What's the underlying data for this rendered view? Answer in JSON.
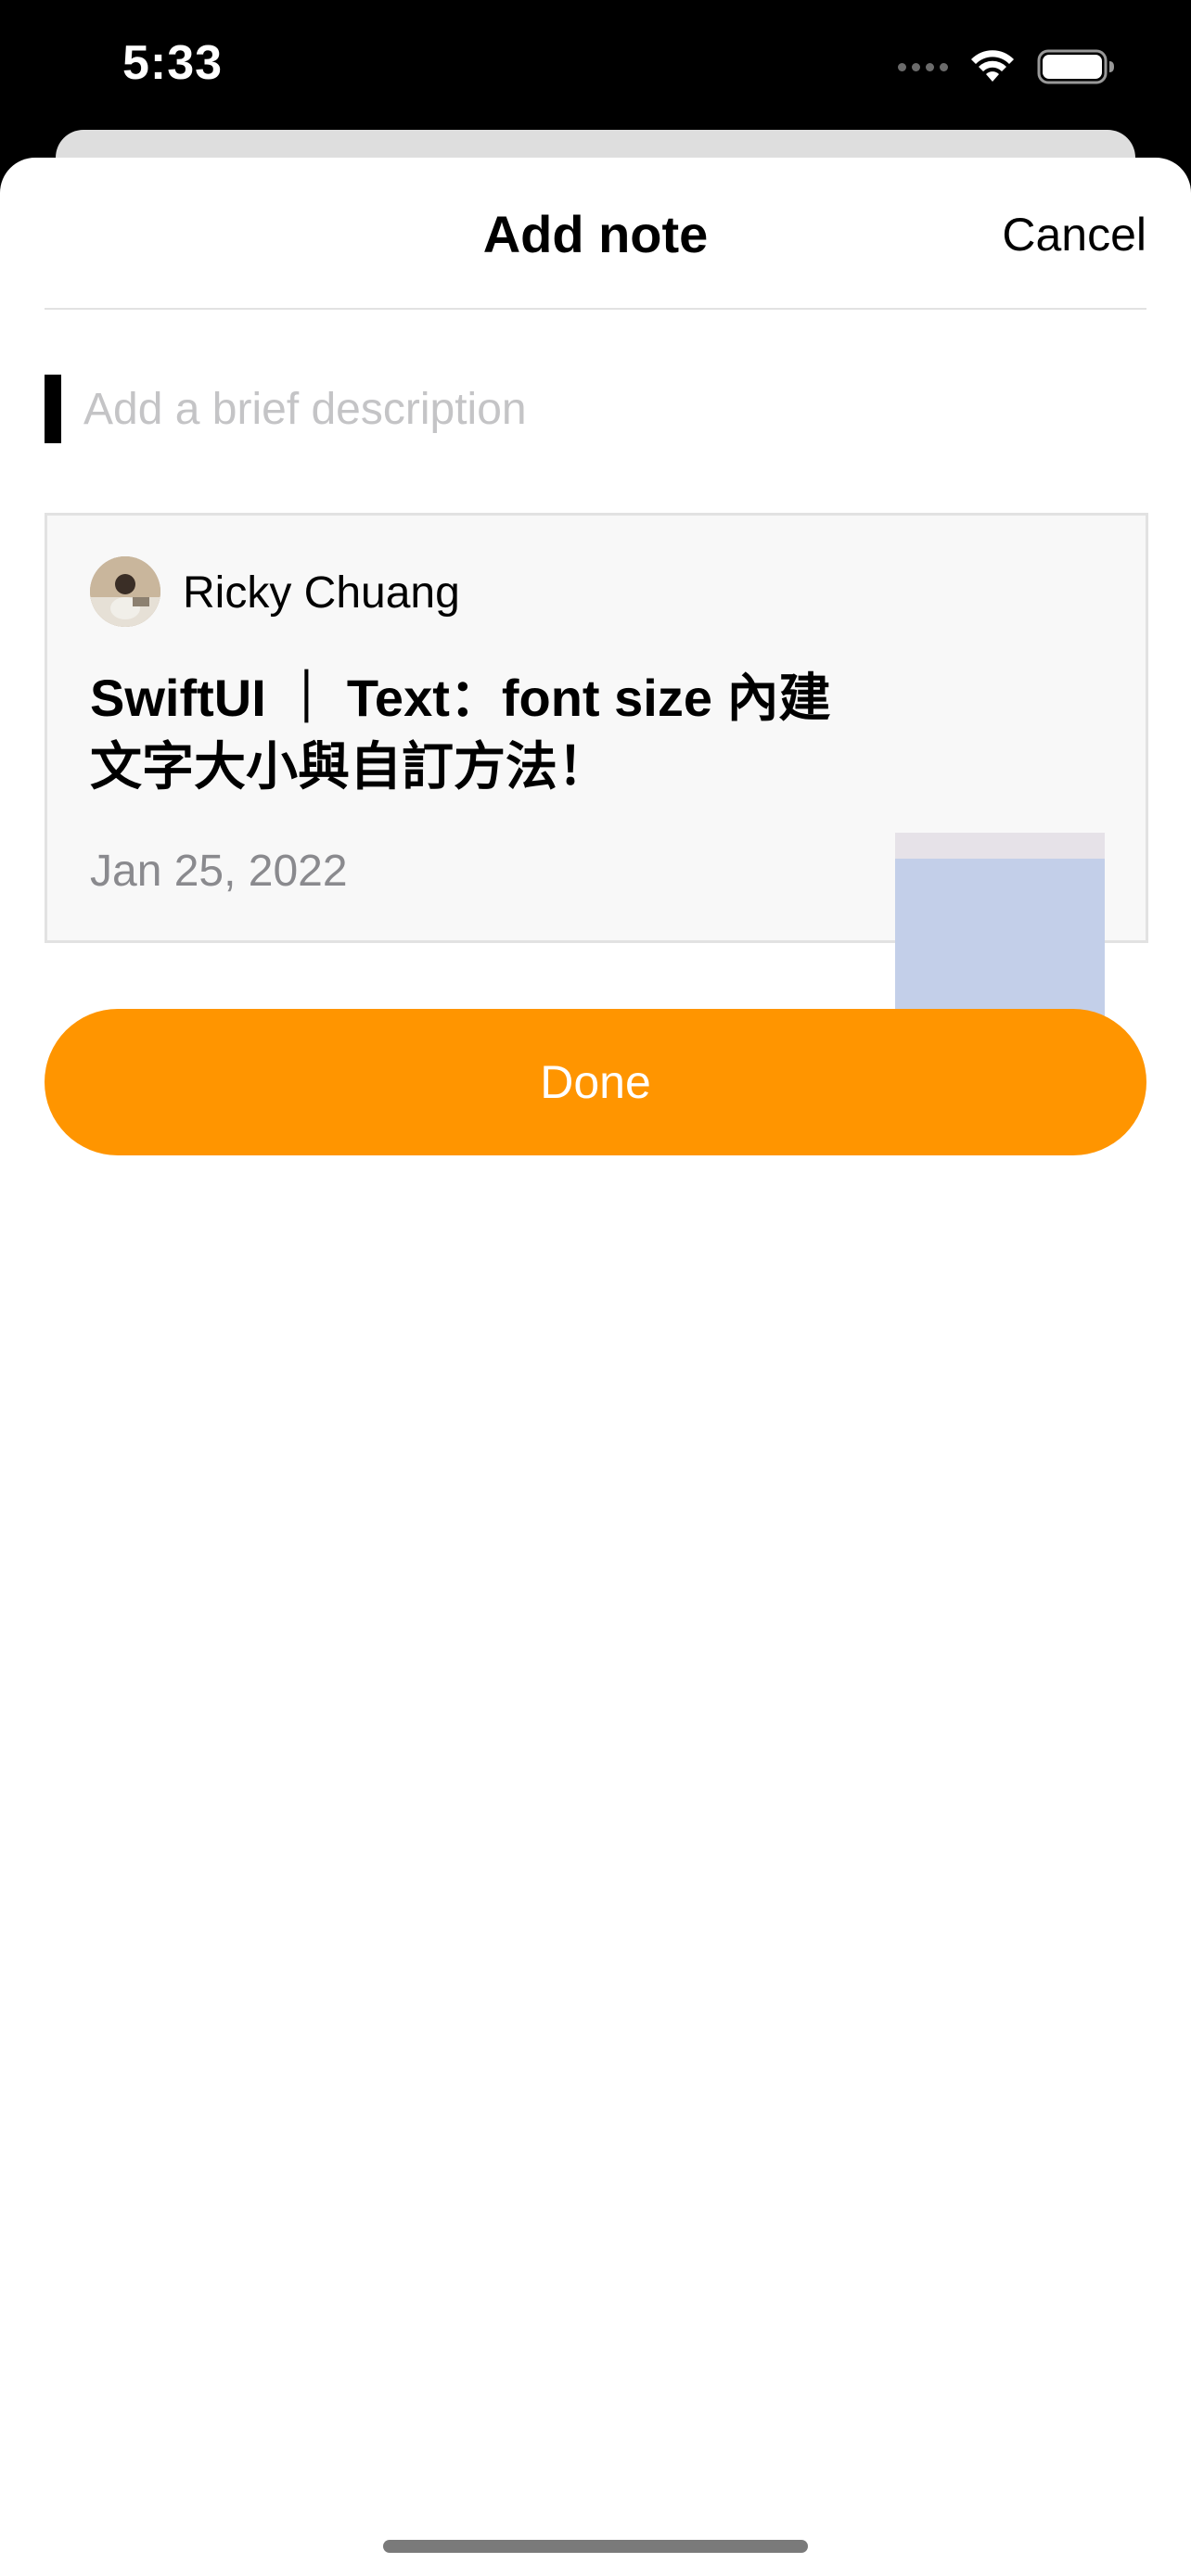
{
  "status_bar": {
    "time": "5:33"
  },
  "nav": {
    "title": "Add note",
    "cancel_label": "Cancel"
  },
  "description": {
    "placeholder": "Add a brief description",
    "value": ""
  },
  "card": {
    "author": "Ricky Chuang",
    "title": "SwiftUI ｜ Text：font size 內建文字大小與自訂方法！",
    "date": "Jan 25, 2022"
  },
  "done_button": {
    "label": "Done"
  },
  "colors": {
    "accent": "#ff9500",
    "placeholder": "#c4c4c6",
    "date_text": "#8a8a8e",
    "card_background": "#f8f8f8",
    "card_border": "#e2e2e2"
  },
  "icons": {
    "cellular": "cellular-signal-icon",
    "wifi": "wifi-icon",
    "battery": "battery-icon"
  }
}
